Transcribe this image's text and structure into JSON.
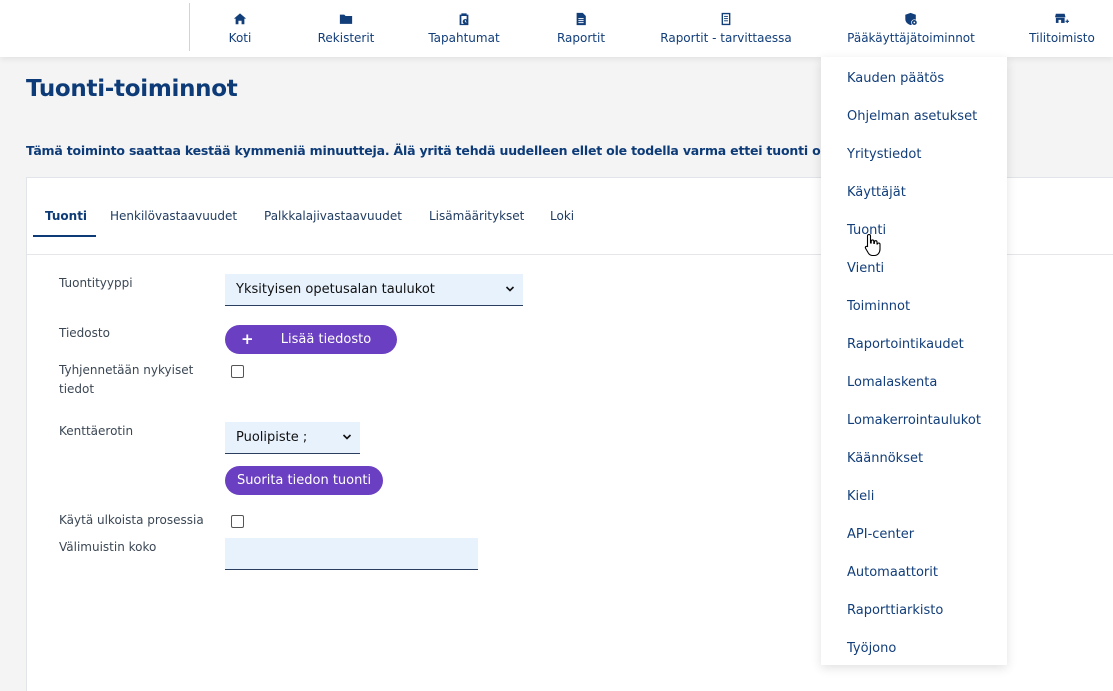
{
  "nav": {
    "items": [
      {
        "label": "Koti",
        "icon": "home-icon"
      },
      {
        "label": "Rekisterit",
        "icon": "folder-icon"
      },
      {
        "label": "Tapahtumat",
        "icon": "clipboard-clock-icon"
      },
      {
        "label": "Raportit",
        "icon": "document-icon"
      },
      {
        "label": "Raportit - tarvittaessa",
        "icon": "receipt-icon"
      },
      {
        "label": "Pääkäyttäjätoiminnot",
        "icon": "shield-gear-icon"
      },
      {
        "label": "Tilitoimisto",
        "icon": "store-plus-icon"
      }
    ]
  },
  "page": {
    "title": "Tuonti-toiminnot",
    "warning": "Tämä toiminto saattaa kestää kymmeniä minuutteja. Älä yritä tehdä uudelleen ellet ole todella varma ettei tuonti ole käynnissä."
  },
  "tabs": [
    "Tuonti",
    "Henkilövastaavuudet",
    "Palkkalajivastaavuudet",
    "Lisämääritykset",
    "Loki"
  ],
  "form": {
    "import_type_label": "Tuontityyppi",
    "import_type_value": "Yksityisen opetusalan taulukot",
    "file_label": "Tiedosto",
    "add_file_button": "Lisää tiedosto",
    "add_file_plus": "+",
    "clear_label": "Tyhjennetään nykyiset tiedot",
    "clear_checked": false,
    "separator_label": "Kenttäerotin",
    "separator_value": "Puolipiste ;",
    "run_button": "Suorita tiedon tuonti",
    "external_label": "Käytä ulkoista prosessia",
    "external_checked": false,
    "cache_label": "Välimuistin koko",
    "cache_value": ""
  },
  "admin_menu": {
    "items": [
      "Kauden päätös",
      "Ohjelman asetukset",
      "Yritystiedot",
      "Käyttäjät",
      "Tuonti",
      "Vienti",
      "Toiminnot",
      "Raportointikaudet",
      "Lomalaskenta",
      "Lomakerrointaulukot",
      "Käännökset",
      "Kieli",
      "API-center",
      "Automaattorit",
      "Raporttiarkisto",
      "Työjono"
    ]
  },
  "colors": {
    "brand_navy": "#0d3b78",
    "accent_purple": "#6a3fc1",
    "input_bg": "#e8f2fd"
  }
}
